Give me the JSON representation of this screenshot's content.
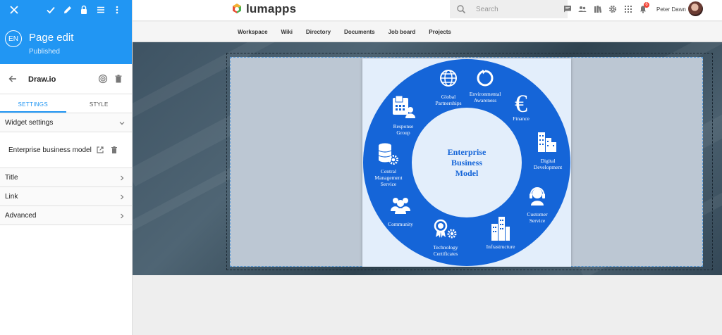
{
  "panel": {
    "header": {
      "avatar_text": "EN",
      "title": "Page edit",
      "status": "Published",
      "toolbar_icons": [
        "close-icon",
        "check-icon",
        "pencil-icon",
        "lock-icon",
        "menu-icon",
        "more-vert-icon"
      ]
    },
    "widget": {
      "name": "Draw.io"
    },
    "tabs": [
      {
        "label": "SETTINGS",
        "active": true
      },
      {
        "label": "STYLE",
        "active": false
      }
    ],
    "widget_settings": {
      "label": "Widget settings",
      "item_label": "Enterprise business model"
    },
    "sections": [
      {
        "label": "Title"
      },
      {
        "label": "Link"
      },
      {
        "label": "Advanced"
      }
    ]
  },
  "topbar": {
    "logo_text": "lumapps",
    "search_placeholder": "Search",
    "notification_count": "6",
    "user_name": "Peter Dawn",
    "icons": [
      "chat-icon",
      "people-icon",
      "library-icon",
      "settings-icon",
      "apps-icon",
      "bell-icon"
    ]
  },
  "nav": {
    "items": [
      "Workspace",
      "Wiki",
      "Directory",
      "Documents",
      "Job board",
      "Projects"
    ]
  },
  "diagram": {
    "center_title": [
      "Enterprise",
      "Business",
      "Model"
    ],
    "segments": {
      "global": [
        "Global",
        "Partnerships"
      ],
      "environmental": [
        "Environmental",
        "Awareness"
      ],
      "finance": [
        "Finance"
      ],
      "digital": [
        "Digital",
        "Development"
      ],
      "customer": [
        "Customer",
        "Service"
      ],
      "infrastructure": [
        "Infrastructure"
      ],
      "technology": [
        "Technology",
        "Certificates"
      ],
      "community": [
        "Community"
      ],
      "central": [
        "Central",
        "Management",
        "Service"
      ],
      "response": [
        "Response",
        "Group"
      ]
    },
    "colors": {
      "ring": "#1565d8",
      "inner": "#e3eefb",
      "title": "#1565d8"
    }
  }
}
